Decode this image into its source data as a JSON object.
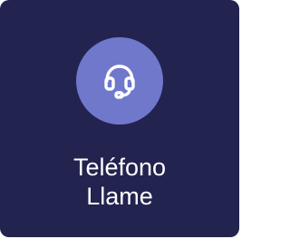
{
  "card": {
    "title": "Teléfono",
    "subtitle": "Llame",
    "icon": "headset-icon",
    "colors": {
      "background": "#23234f",
      "icon_circle": "#7078cc",
      "text": "#ffffff"
    }
  }
}
